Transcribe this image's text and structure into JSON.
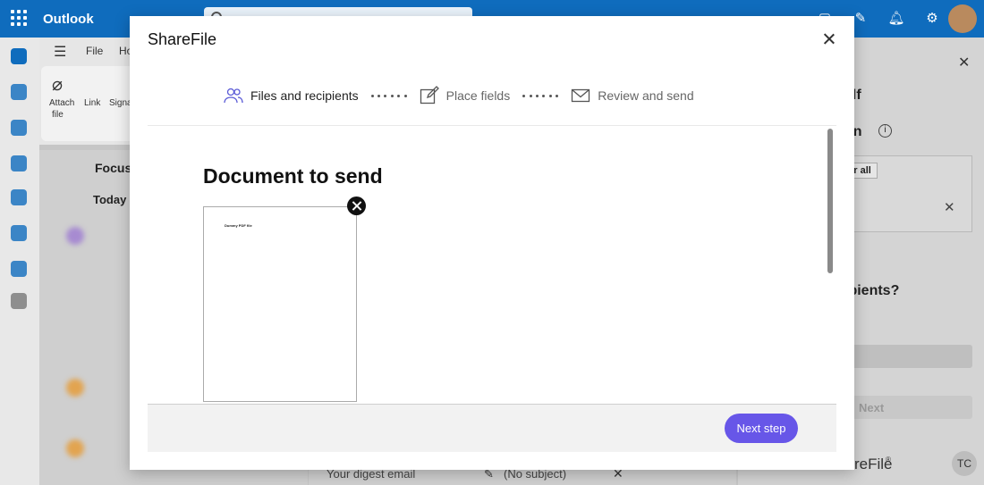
{
  "outlook": {
    "app_name": "Outlook",
    "ribbon": {
      "file": "File",
      "home": "Ho",
      "attach_file": "Attach",
      "attach_file_2": "file",
      "link": "Link",
      "signature": "Signa"
    },
    "mail_list": {
      "focused_tab": "Focuse",
      "today_group": "Today"
    },
    "right_pane": {
      "title_fragment": "elf",
      "sign_fragment": "gn",
      "clear_all": "ear all",
      "recipients_fragment": "ipients?",
      "next_fragment": "Next",
      "brand_fragment": "reFile",
      "brand_mark": "®",
      "user_initials": "TC"
    },
    "compose": {
      "from": "Your digest email",
      "subject": "(No subject)"
    }
  },
  "modal": {
    "title": "ShareFile",
    "steps": [
      {
        "label": "Files and recipients",
        "icon": "people-icon",
        "active": true
      },
      {
        "label": "Place fields",
        "icon": "edit-icon",
        "active": false
      },
      {
        "label": "Review and send",
        "icon": "mail-icon",
        "active": false
      }
    ],
    "heading": "Document to send",
    "document_thumbnail_text": "Dummy PDF file",
    "next_button": "Next step",
    "colors": {
      "accent": "#6756e8",
      "footer": "#f2f2f2"
    }
  }
}
